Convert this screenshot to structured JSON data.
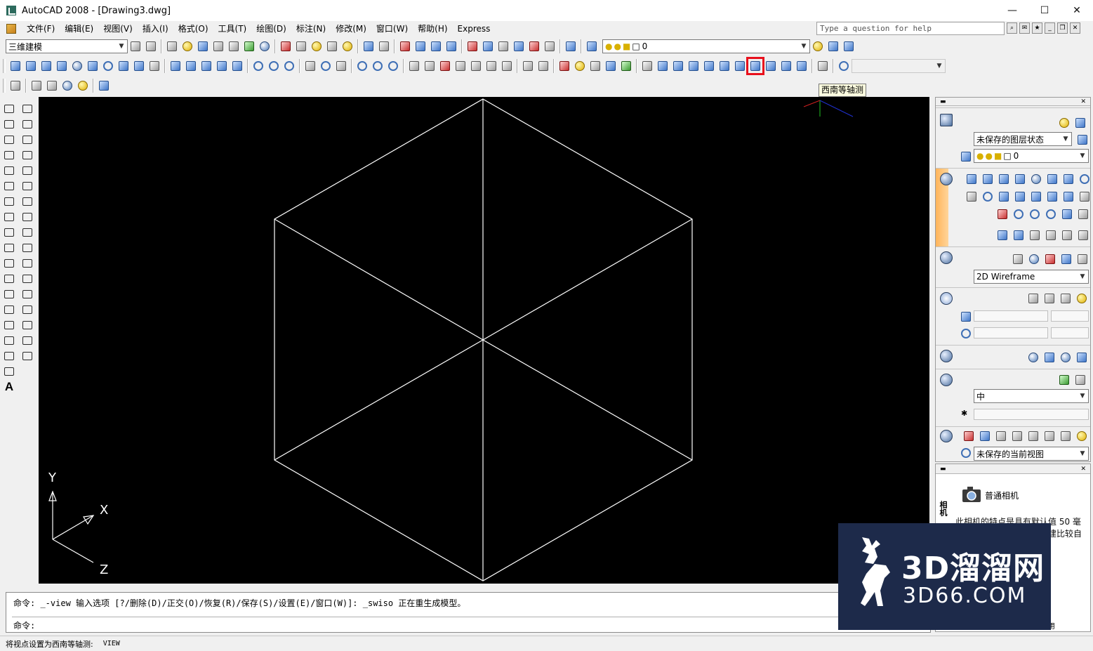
{
  "window": {
    "title": "AutoCAD 2008 - [Drawing3.dwg]",
    "minimize_glyph": "—",
    "maximize_glyph": "☐",
    "close_glyph": "✕"
  },
  "menu": {
    "items": [
      "文件(F)",
      "编辑(E)",
      "视图(V)",
      "插入(I)",
      "格式(O)",
      "工具(T)",
      "绘图(D)",
      "标注(N)",
      "修改(M)",
      "窗口(W)",
      "帮助(H)",
      "Express"
    ],
    "help_placeholder": "Type a question for help"
  },
  "toolbar": {
    "workspace": "三维建模",
    "layer_value": "0",
    "tooltip": "西南等轴测",
    "highlighted_button": "view-sw-isometric-button"
  },
  "viewport": {
    "background": "#000000",
    "ucs": {
      "y_label": "Y",
      "x_label": "X",
      "z_label": "Z"
    }
  },
  "dashboard": {
    "layer_state": "未保存的图层状态",
    "layer_value": "0",
    "visual_style": "2D Wireframe",
    "material_quality": "中",
    "named_view": "未保存的当前视图",
    "accent_color": "#ffb45a"
  },
  "palette": {
    "tab_label": "相机",
    "camera_name": "普通相机",
    "description": "此相机的特点是具有默认值 50 毫米镜头长度。此相机可创建比较自然",
    "bottom_text": "使用"
  },
  "command": {
    "line1": "命令: _-view 输入选项 [?/删除(D)/正交(O)/恢复(R)/保存(S)/设置(E)/窗口(W)]: _swiso 正在重生成模型。",
    "line2": "命令:"
  },
  "status": {
    "text": "将视点设置为西南等轴测:",
    "command_name": "VIEW"
  },
  "watermark": {
    "line1": "3D溜溜网",
    "line2": "3D66.COM",
    "color": "#1d2a4a"
  }
}
